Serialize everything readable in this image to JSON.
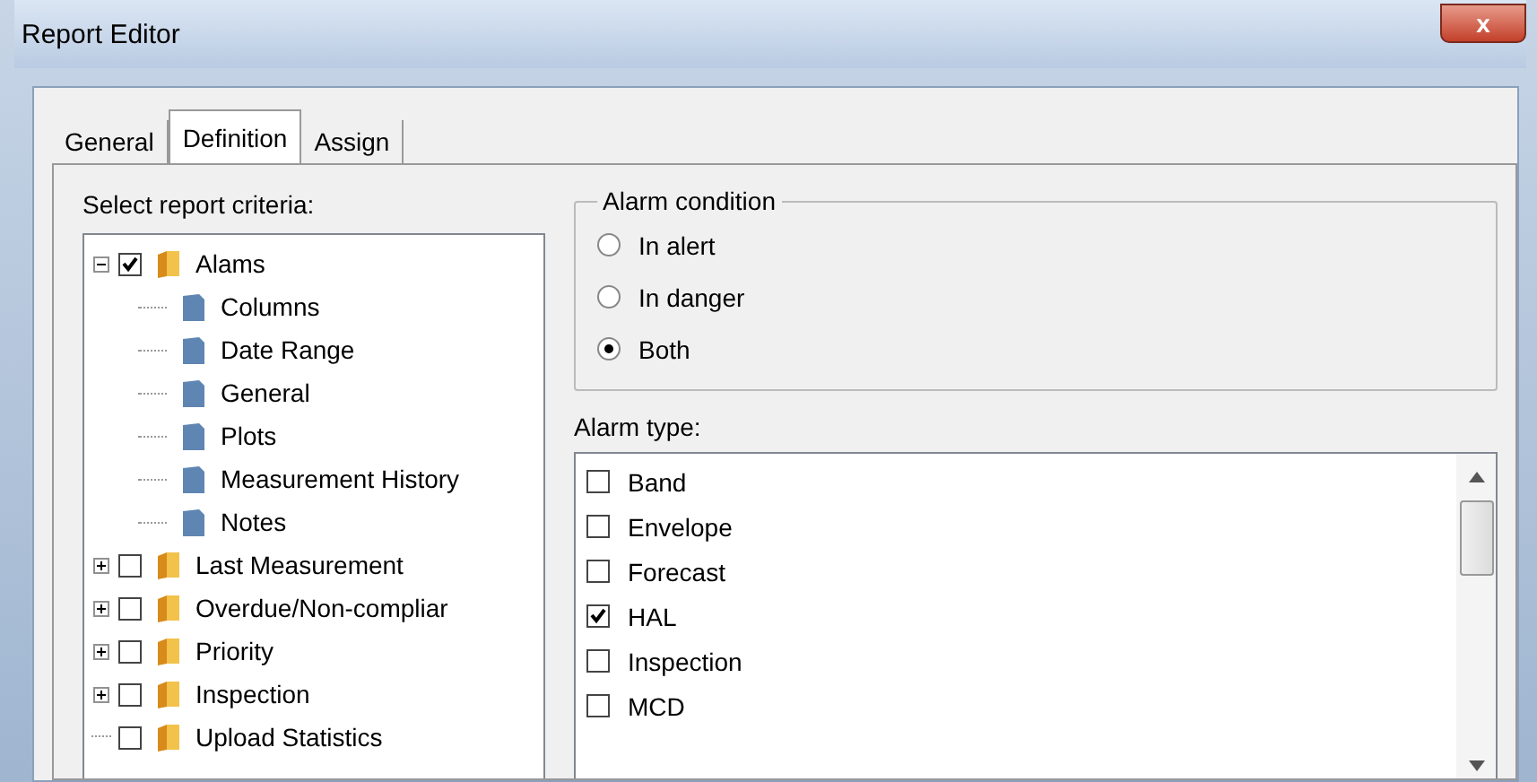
{
  "window": {
    "title": "Report Editor",
    "close_label": "x"
  },
  "tabs": [
    {
      "label": "General",
      "selected": false
    },
    {
      "label": "Definition",
      "selected": true
    },
    {
      "label": "Assign",
      "selected": false
    }
  ],
  "criteria_label": "Select report criteria:",
  "tree": [
    {
      "label": "Alams",
      "checked": true,
      "expanded": true,
      "children": [
        {
          "label": "Columns"
        },
        {
          "label": "Date Range"
        },
        {
          "label": "General"
        },
        {
          "label": "Plots"
        },
        {
          "label": "Measurement History"
        },
        {
          "label": "Notes"
        }
      ]
    },
    {
      "label": "Last Measurement",
      "checked": false,
      "expanded": false
    },
    {
      "label": "Overdue/Non-compliar",
      "checked": false,
      "expanded": false
    },
    {
      "label": "Priority",
      "checked": false,
      "expanded": false
    },
    {
      "label": "Inspection",
      "checked": false,
      "expanded": false
    },
    {
      "label": "Upload Statistics",
      "checked": false
    }
  ],
  "alarm_condition": {
    "title": "Alarm condition",
    "options": [
      {
        "label": "In alert",
        "selected": false
      },
      {
        "label": "In danger",
        "selected": false
      },
      {
        "label": "Both",
        "selected": true
      }
    ]
  },
  "alarm_type": {
    "label": "Alarm type:",
    "items": [
      {
        "label": "Band",
        "checked": false
      },
      {
        "label": "Envelope",
        "checked": false
      },
      {
        "label": "Forecast",
        "checked": false
      },
      {
        "label": "HAL",
        "checked": true
      },
      {
        "label": "Inspection",
        "checked": false
      },
      {
        "label": "MCD",
        "checked": false
      }
    ]
  }
}
